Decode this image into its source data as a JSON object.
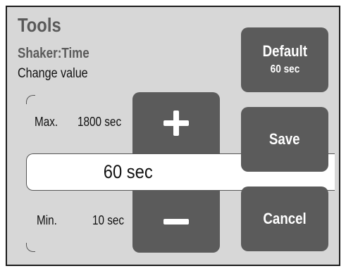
{
  "header": {
    "title": "Tools",
    "subtitle": "Shaker:Time",
    "hint": "Change value"
  },
  "stepper": {
    "max_label": "Max.",
    "max_value": "1800 sec",
    "min_label": "Min.",
    "min_value": "10 sec",
    "current_value": "60 sec",
    "increment_icon": "plus-icon",
    "decrement_icon": "minus-icon"
  },
  "actions": {
    "default_label": "Default",
    "default_value": "60 sec",
    "save_label": "Save",
    "cancel_label": "Cancel"
  },
  "colors": {
    "screen_bg": "#d7d7d7",
    "button_bg": "#5b5b5b",
    "title_text": "#5a5a5a"
  }
}
